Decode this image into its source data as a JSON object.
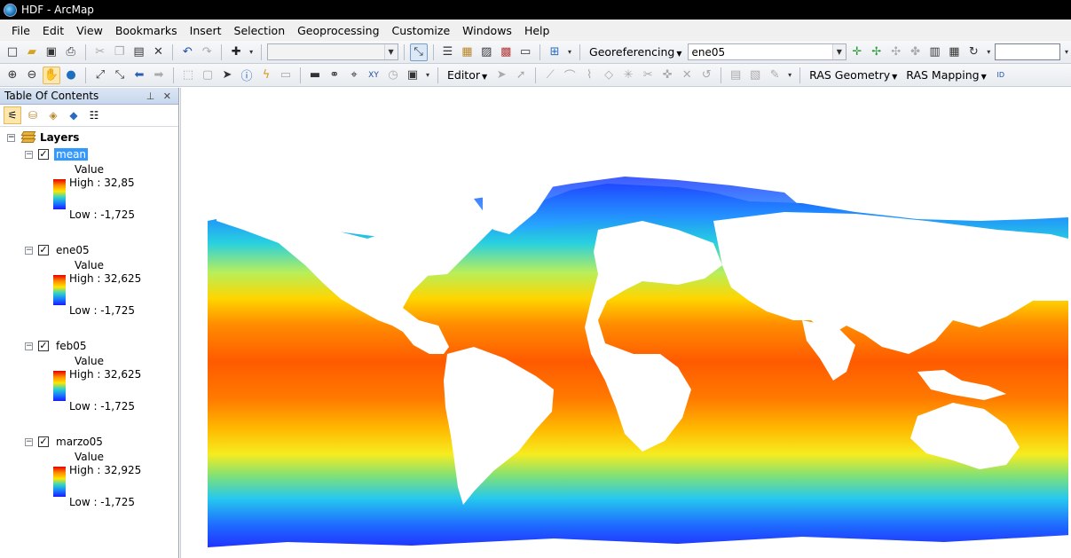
{
  "window": {
    "title": "HDF - ArcMap"
  },
  "menu": [
    "File",
    "Edit",
    "View",
    "Bookmarks",
    "Insert",
    "Selection",
    "Geoprocessing",
    "Customize",
    "Windows",
    "Help"
  ],
  "toolbar": {
    "georeferencing_label": "Georeferencing",
    "layer_combo_value": "ene05",
    "editor_label": "Editor",
    "ras_geometry_label": "RAS Geometry",
    "ras_mapping_label": "RAS Mapping"
  },
  "toc": {
    "title": "Table Of Contents",
    "root_label": "Layers",
    "legend_title": "Value",
    "layers": [
      {
        "name": "mean",
        "high": "High : 32,85",
        "low": "Low : -1,725",
        "checked": true,
        "selected": true
      },
      {
        "name": "ene05",
        "high": "High : 32,625",
        "low": "Low : -1,725",
        "checked": true,
        "selected": false
      },
      {
        "name": "feb05",
        "high": "High : 32,625",
        "low": "Low : -1,725",
        "checked": true,
        "selected": false
      },
      {
        "name": "marzo05",
        "high": "High : 32,925",
        "low": "Low : -1,725",
        "checked": true,
        "selected": false
      }
    ]
  },
  "colors": {
    "ramp_high": "#e60000",
    "ramp_mid": "#ffe600",
    "ramp_low": "#1a1aff",
    "selection": "#3399ff"
  }
}
